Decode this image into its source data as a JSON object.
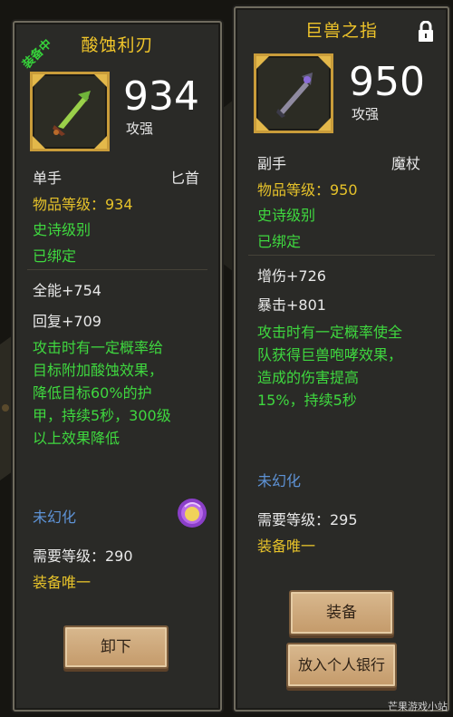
{
  "left_item": {
    "equipped_badge": "装备中",
    "name": "酸蚀利刃",
    "stat_value": "934",
    "stat_label": "攻强",
    "slot": "单手",
    "type": "匕首",
    "item_level": "物品等级：934",
    "quality": "史诗级别",
    "bound": "已绑定",
    "stats": [
      "全能+754",
      "回复+709"
    ],
    "effect": "攻击时有一定概率给目标附加酸蚀效果，降低目标60%的护甲，持续5秒，300级以上效果降低",
    "transmog": "未幻化",
    "required_level": "需要等级：290",
    "unique": "装备唯一",
    "button": "卸下",
    "orb_icon": "transmog-orb-icon"
  },
  "right_item": {
    "name": "巨兽之指",
    "stat_value": "950",
    "stat_label": "攻强",
    "slot": "副手",
    "type": "魔杖",
    "item_level": "物品等级：950",
    "quality": "史诗级别",
    "bound": "已绑定",
    "stats": [
      "增伤+726",
      "暴击+801"
    ],
    "effect": "攻击时有一定概率使全队获得巨兽咆哮效果，造成的伤害提高15%，持续5秒",
    "transmog": "未幻化",
    "required_level": "需要等级：295",
    "unique": "装备唯一",
    "button_equip": "装备",
    "button_bank": "放入个人银行",
    "lock_icon": "lock-icon"
  },
  "watermark": "芒果游戏小站",
  "colors": {
    "title_gold": "#f0c52a",
    "epic_green": "#3fd83f",
    "transmog_blue": "#5e93d6",
    "button_tan": "#c49a6a"
  }
}
